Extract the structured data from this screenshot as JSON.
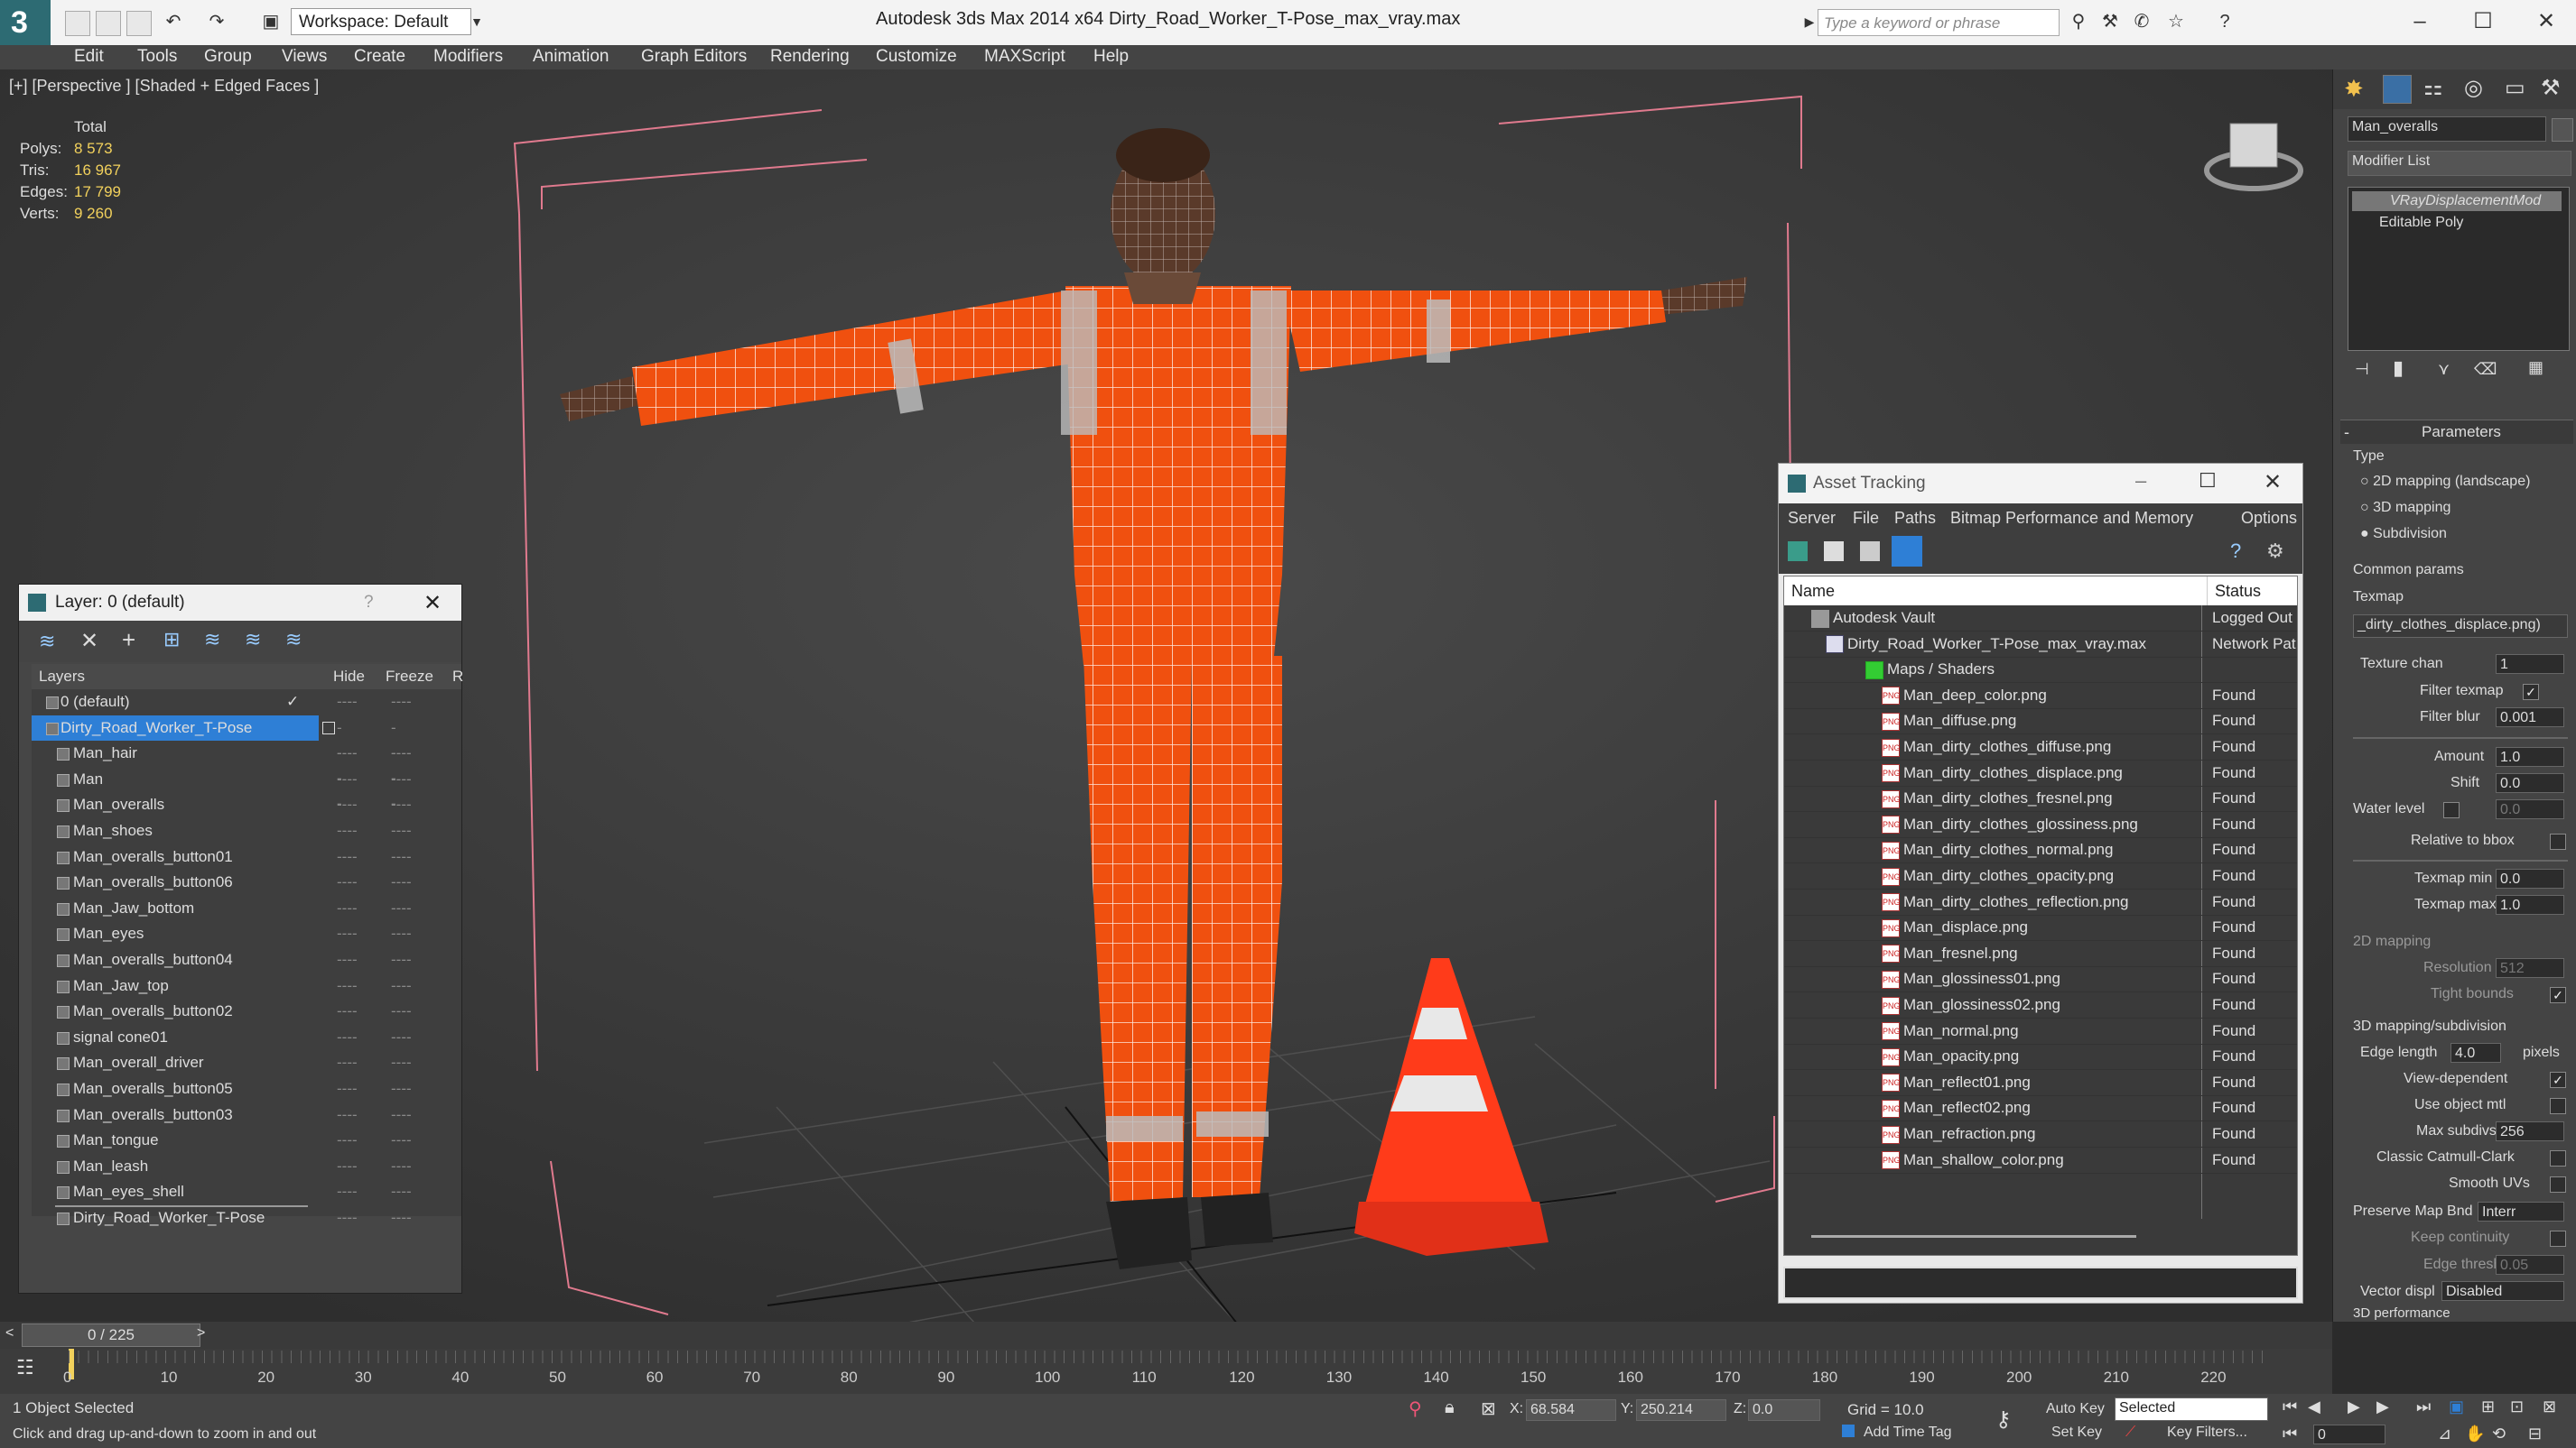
{
  "window": {
    "title": "Autodesk 3ds Max  2014 x64     Dirty_Road_Worker_T-Pose_max_vray.max",
    "workspace": "Workspace: Default",
    "search_placeholder": "Type a keyword or phrase"
  },
  "menu": [
    "Edit",
    "Tools",
    "Group",
    "Views",
    "Create",
    "Modifiers",
    "Animation",
    "Graph Editors",
    "Rendering",
    "Customize",
    "MAXScript",
    "Help"
  ],
  "viewport": {
    "label": "[+] [Perspective ] [Shaded + Edged Faces ]",
    "stats": {
      "total": "Total",
      "rows": [
        {
          "k": "Polys:",
          "v": "8 573"
        },
        {
          "k": "Tris:",
          "v": "16 967"
        },
        {
          "k": "Edges:",
          "v": "17 799"
        },
        {
          "k": "Verts:",
          "v": "9 260"
        }
      ]
    }
  },
  "layer_panel": {
    "title": "Layer: 0 (default)",
    "help": "?",
    "col_layers": "Layers",
    "col_hide": "Hide",
    "col_freeze": "Freeze",
    "col_r": "R",
    "dash": "----",
    "layers": [
      {
        "name": "0 (default)"
      },
      {
        "name": "Dirty_Road_Worker_T-Pose"
      },
      {
        "name": "Man_hair"
      },
      {
        "name": "Man"
      },
      {
        "name": "Man_overalls"
      },
      {
        "name": "Man_shoes"
      },
      {
        "name": "Man_overalls_button01"
      },
      {
        "name": "Man_overalls_button06"
      },
      {
        "name": "Man_Jaw_bottom"
      },
      {
        "name": "Man_eyes"
      },
      {
        "name": "Man_overalls_button04"
      },
      {
        "name": "Man_Jaw_top"
      },
      {
        "name": "Man_overalls_button02"
      },
      {
        "name": "signal cone01"
      },
      {
        "name": "Man_overall_driver"
      },
      {
        "name": "Man_overalls_button05"
      },
      {
        "name": "Man_overalls_button03"
      },
      {
        "name": "Man_tongue"
      },
      {
        "name": "Man_leash"
      },
      {
        "name": "Man_eyes_shell"
      },
      {
        "name": "Dirty_Road_Worker_T-Pose"
      }
    ]
  },
  "asset_tracking": {
    "title": "Asset Tracking",
    "menu": [
      "Server",
      "File",
      "Paths",
      "Bitmap Performance and Memory",
      "Options"
    ],
    "col_name": "Name",
    "col_status": "Status",
    "rows": [
      {
        "name": "Autodesk Vault",
        "status": "Logged Out"
      },
      {
        "name": "Dirty_Road_Worker_T-Pose_max_vray.max",
        "status": "Network Pat"
      },
      {
        "name": "Maps / Shaders",
        "status": ""
      },
      {
        "name": "Man_deep_color.png",
        "status": "Found"
      },
      {
        "name": "Man_diffuse.png",
        "status": "Found"
      },
      {
        "name": "Man_dirty_clothes_diffuse.png",
        "status": "Found"
      },
      {
        "name": "Man_dirty_clothes_displace.png",
        "status": "Found"
      },
      {
        "name": "Man_dirty_clothes_fresnel.png",
        "status": "Found"
      },
      {
        "name": "Man_dirty_clothes_glossiness.png",
        "status": "Found"
      },
      {
        "name": "Man_dirty_clothes_normal.png",
        "status": "Found"
      },
      {
        "name": "Man_dirty_clothes_opacity.png",
        "status": "Found"
      },
      {
        "name": "Man_dirty_clothes_reflection.png",
        "status": "Found"
      },
      {
        "name": "Man_displace.png",
        "status": "Found"
      },
      {
        "name": "Man_fresnel.png",
        "status": "Found"
      },
      {
        "name": "Man_glossiness01.png",
        "status": "Found"
      },
      {
        "name": "Man_glossiness02.png",
        "status": "Found"
      },
      {
        "name": "Man_normal.png",
        "status": "Found"
      },
      {
        "name": "Man_opacity.png",
        "status": "Found"
      },
      {
        "name": "Man_reflect01.png",
        "status": "Found"
      },
      {
        "name": "Man_reflect02.png",
        "status": "Found"
      },
      {
        "name": "Man_refraction.png",
        "status": "Found"
      },
      {
        "name": "Man_shallow_color.png",
        "status": "Found"
      }
    ]
  },
  "command_panel": {
    "object_name": "Man_overalls",
    "modifier_list": "Modifier List",
    "stack": [
      "VRayDisplacementMod",
      "Editable Poly"
    ],
    "parameters": "Parameters",
    "type_label": "Type",
    "type_options": [
      "2D mapping (landscape)",
      "3D mapping",
      "Subdivision"
    ],
    "common_params": "Common params",
    "texmap": "Texmap",
    "texmap_value": "_dirty_clothes_displace.png)",
    "texture_chan": {
      "label": "Texture chan",
      "value": "1"
    },
    "filter_texmap": "Filter texmap",
    "filter_blur": {
      "label": "Filter blur",
      "value": "0.001"
    },
    "amount": {
      "label": "Amount",
      "value": "1.0"
    },
    "shift": {
      "label": "Shift",
      "value": "0.0"
    },
    "water_level": {
      "label": "Water level",
      "value": "0.0"
    },
    "relative_bbox": "Relative to bbox",
    "texmap_min": {
      "label": "Texmap min",
      "value": "0.0"
    },
    "texmap_max": {
      "label": "Texmap max",
      "value": "1.0"
    },
    "mapping_2d": "2D mapping",
    "resolution": {
      "label": "Resolution",
      "value": "512"
    },
    "tight_bounds": "Tight bounds",
    "mapping_3d": "3D mapping/subdivision",
    "edge_length": {
      "label": "Edge length",
      "value": "4.0",
      "unit": "pixels"
    },
    "view_dependent": "View-dependent",
    "use_object_mtl": "Use object mtl",
    "max_subdivs": {
      "label": "Max subdivs",
      "value": "256"
    },
    "classic_catmull": "Classic Catmull-Clark",
    "smooth_uvs": "Smooth UVs",
    "preserve_map_bnd": {
      "label": "Preserve Map Bnd",
      "value": "Interr"
    },
    "keep_continuity": "Keep continuity",
    "edge_thresh": {
      "label": "Edge thresh",
      "value": "0.05"
    },
    "vector_displ": {
      "label": "Vector displ",
      "value": "Disabled"
    },
    "perf": "3D performance"
  },
  "timeline": {
    "frame": "0 / 225",
    "ticks": [
      "0",
      "10",
      "20",
      "30",
      "40",
      "50",
      "60",
      "70",
      "80",
      "90",
      "100",
      "110",
      "120",
      "130",
      "140",
      "150",
      "160",
      "170",
      "180",
      "190",
      "200",
      "210",
      "220"
    ]
  },
  "status": {
    "selected": "1 Object Selected",
    "hint": "Click and drag up-and-down to zoom in and out",
    "x_label": "X:",
    "x": "68.584",
    "y_label": "Y:",
    "y": "250.214",
    "z_label": "Z:",
    "z": "0.0",
    "grid": "Grid = 10.0",
    "auto_key": "Auto Key",
    "set_key": "Set Key",
    "selected_dropdown": "Selected",
    "key_filters": "Key Filters...",
    "add_time_tag": "Add Time Tag",
    "frame_field": "0"
  },
  "colors": {
    "accent": "#2e7fd6",
    "overalls": "#ff5a14",
    "cone": "#ff3b1a",
    "stats_value": "#f2d15c"
  }
}
